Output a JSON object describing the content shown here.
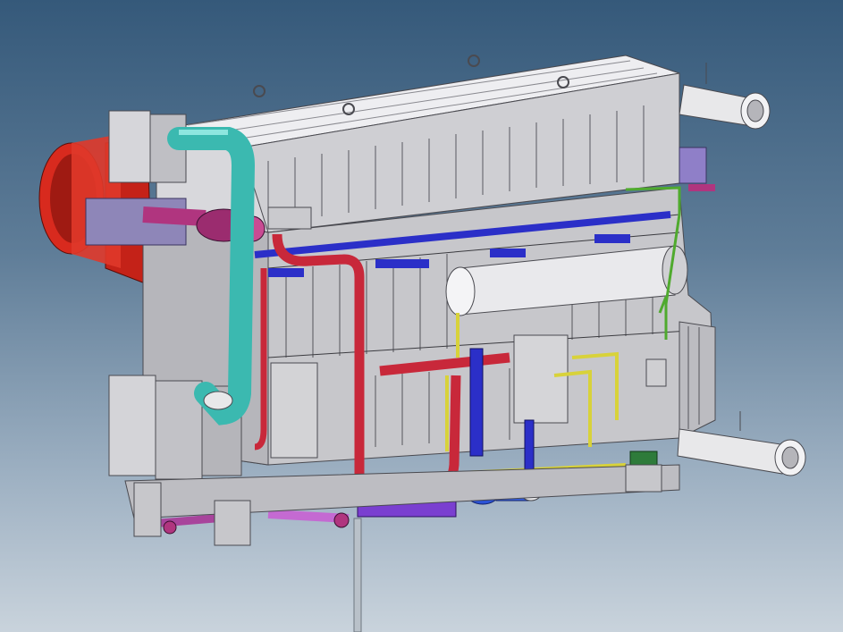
{
  "viewport": {
    "background_top": "#35597a",
    "background_bottom": "#c9d3dc",
    "view_mode": "shaded-with-edges"
  },
  "model": {
    "components": [
      {
        "name": "main-shell",
        "color": "#c9c9cc"
      },
      {
        "name": "top-header-box",
        "color": "#dcdce0"
      },
      {
        "name": "exhaust-flue",
        "color": "#d82a1e"
      },
      {
        "name": "cyan-chilled-water-pipe",
        "color": "#3bb9b0"
      },
      {
        "name": "red-hot-water-pipe",
        "color": "#c8283a"
      },
      {
        "name": "blue-header-pipe",
        "color": "#2b2fc8"
      },
      {
        "name": "magenta-nozzle-pipe",
        "color": "#b0357f"
      },
      {
        "name": "yellow-instrument-lines",
        "color": "#d8d23a"
      },
      {
        "name": "outlet-pipe-top-right",
        "color": "#e8e8ea"
      },
      {
        "name": "outlet-pipe-bottom-right",
        "color": "#e8e8ea"
      },
      {
        "name": "cylindrical-drum",
        "color": "#e9e9ec"
      },
      {
        "name": "solution-pump",
        "color": "#2b53d6"
      },
      {
        "name": "control-panel-box",
        "color": "#d3d3d6"
      },
      {
        "name": "base-frame",
        "color": "#bdbdc2"
      }
    ]
  }
}
